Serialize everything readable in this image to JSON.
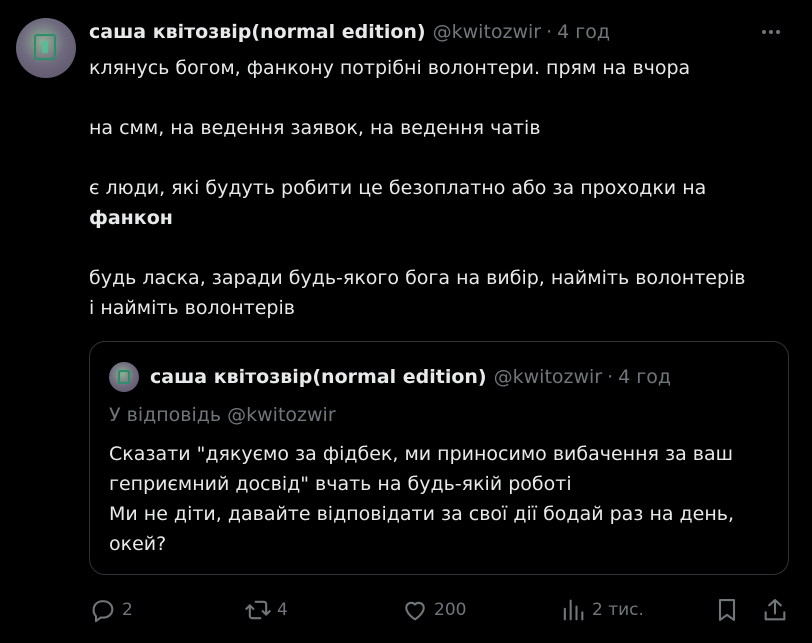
{
  "tweet": {
    "author_name": "саша квітозвір(normal edition)",
    "handle": "@kwitozwir",
    "separator": "·",
    "time": "4 год",
    "lines": [
      "клянусь богом, фанкону потрібні волонтери. прям на вчора",
      "на смм, на ведення заявок, на ведення чатів",
      "є люди, які будуть робити це безоплатно або за проходки на",
      "фанкон",
      "будь ласка, заради будь-якого бога на вибір, найміть волонтерів",
      "і найміть волонтерів"
    ]
  },
  "quote": {
    "author_name": "саша квітозвір(normal edition)",
    "handle": "@kwitozwir",
    "separator": "·",
    "time": "4 год",
    "reply_to": "У відповідь @kwitozwir",
    "lines": [
      "Сказати \"дякуємо за фідбек, ми приносимо вибачення за ваш",
      "геприємний досвід\" вчать на будь-якій роботі",
      "Ми не діти, давайте відповідати за свої дії бодай раз на день,",
      "окей?"
    ]
  },
  "actions": {
    "replies": "2",
    "reposts": "4",
    "likes": "200",
    "views": "2 тис.",
    "icons": [
      "reply-icon",
      "repost-icon",
      "like-icon",
      "views-icon",
      "bookmark-icon",
      "share-icon"
    ]
  },
  "colors": {
    "background": "#000000",
    "text": "#e7e9ea",
    "muted": "#71767b",
    "border": "#2f3336"
  }
}
